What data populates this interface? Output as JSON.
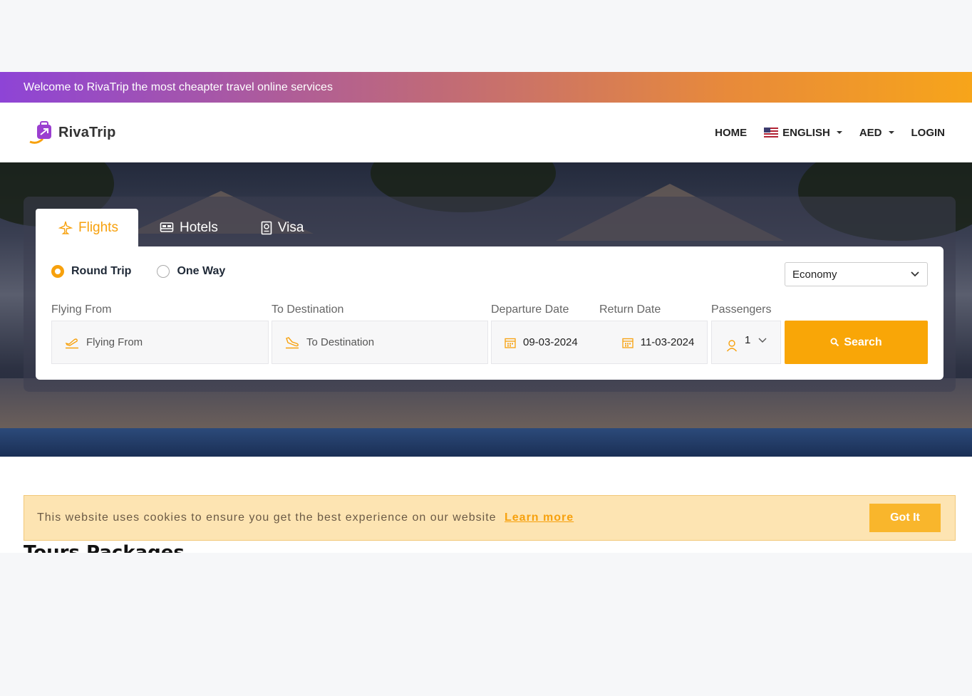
{
  "welcome_bar": {
    "text": "Welcome to RivaTrip the most cheapter travel online services"
  },
  "header": {
    "logo_text": "RivaTrip",
    "nav": {
      "home": "HOME",
      "language": "ENGLISH",
      "currency": "AED",
      "login": "LOGIN"
    }
  },
  "search": {
    "tabs": [
      {
        "label": "Flights",
        "icon": "plane-icon",
        "active": true
      },
      {
        "label": "Hotels",
        "icon": "bed-icon",
        "active": false
      },
      {
        "label": "Visa",
        "icon": "passport-icon",
        "active": false
      }
    ],
    "trip_types": {
      "round_trip": "Round Trip",
      "one_way": "One Way",
      "selected": "Round Trip"
    },
    "cabin_class": "Economy",
    "labels": {
      "flying_from": "Flying From",
      "to_destination": "To Destination",
      "departure_date": "Departure Date",
      "return_date": "Return Date",
      "passengers": "Passengers"
    },
    "placeholders": {
      "flying_from": "Flying From",
      "to_destination": "To Destination"
    },
    "values": {
      "departure_date": "09-03-2024",
      "return_date": "11-03-2024",
      "passengers": "1"
    },
    "search_button": "Search"
  },
  "cookie_banner": {
    "text": "This website uses cookies to ensure you get the best experience on our website",
    "link": "Learn more",
    "button": "Got It"
  },
  "section_title": "Tours Packages",
  "colors": {
    "accent": "#f9a607",
    "accent_text": "#f7a10d",
    "cookie_bg": "#fde4b2"
  }
}
